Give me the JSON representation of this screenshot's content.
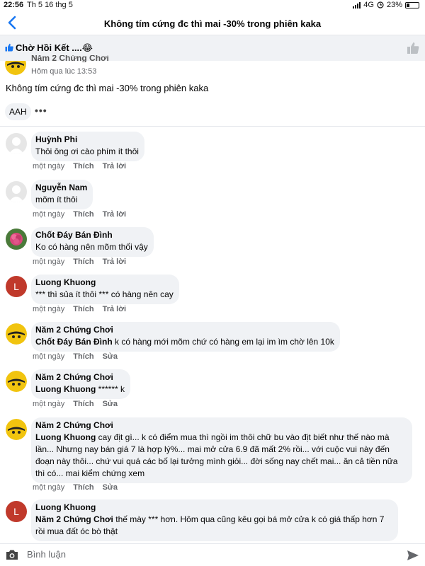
{
  "statusbar": {
    "time": "22:56",
    "date": "Th 5 16 thg 5",
    "network": "4G",
    "battery": "23%"
  },
  "nav": {
    "title": "Không tím cứng đc thì mai -30% trong phiên kaka"
  },
  "group": {
    "name": "Chờ Hồi Kết ....😂"
  },
  "post": {
    "author": "Năm 2 Chứng Chơi",
    "time": "Hôm qua lúc 13:53",
    "text": "Không tím cứng đc thì mai -30% trong phiên kaka",
    "reaction": "AAH",
    "more": "•••"
  },
  "labels": {
    "day": "một ngày",
    "like": "Thích",
    "reply": "Trả lời",
    "edit": "Sửa"
  },
  "comments": [
    {
      "name": "Huỳnh Phi",
      "text": "Thôi ông ơi cào phím ít thôi"
    },
    {
      "name": "Nguyễn Nam",
      "text": "mõm ít thôi"
    },
    {
      "name": "Chốt Đáy Bán Đình",
      "text": "Ko có hàng nên mõm thối vậy"
    },
    {
      "name": "Luong Khuong",
      "avatar_letter": "L",
      "text": "*** thì sủa ít thôi *** có hàng nên cay"
    },
    {
      "name": "Năm 2 Chứng Chơi",
      "mention": "Chốt Đáy Bán Đình",
      "text": " k có hàng mới mõm chứ có hàng em lại im ìm chờ lên 10k"
    },
    {
      "name": "Năm 2 Chứng Chơi",
      "mention": "Luong Khuong",
      "text": " ****** k"
    },
    {
      "name": "Năm 2 Chứng Chơi",
      "mention": "Luong Khuong",
      "text": " cay địt gì... k có điểm mua thì ngồi im thôi chữ bu vào địt biết như thế nào mà lần... Nhưng nay bán giá 7 là hợp lý%... mai mở cửa 6.9 đã mất 2% rồi... với cuộc vui này đến đoạn này thôi... chứ vui quá các bố lại tưởng mình giỏi... đời sống nay chết mai... ăn cả tiền nữa thì có... mai kiểm chứng xem"
    },
    {
      "name": "Luong Khuong",
      "avatar_letter": "L",
      "mention": "Năm 2 Chứng Chơi",
      "text": " thế mày *** hơn. Hôm qua cũng kêu gọi bá mở cửa k có giá thấp hơn 7 rồi mua đất óc bò thật"
    }
  ],
  "composer": {
    "placeholder": "Bình luận"
  },
  "colors": {
    "accent": "#1877f2",
    "bubble": "#f0f2f5",
    "secondary_text": "#65676b",
    "letter_avatar": "#c0392b"
  }
}
